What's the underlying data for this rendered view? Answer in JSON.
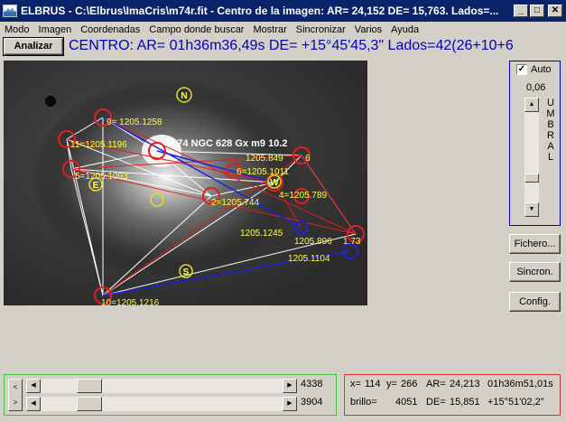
{
  "window": {
    "app_name": "ELBRUS",
    "title": "ELBRUS - C:\\Elbrus\\ImaCris\\m74r.fit - Centro de la imagen: AR= 24,152 DE= 15,763. Lados=..."
  },
  "controls": {
    "minimize": "_",
    "maximize": "□",
    "close": "✕"
  },
  "menu": [
    "Modo",
    "Imagen",
    "Coordenadas",
    "Campo donde buscar",
    "Mostrar",
    "Sincronizar",
    "Varios",
    "Ayuda"
  ],
  "toolbar": {
    "analizar_label": "Analizar",
    "centro_text": "CENTRO: AR= 01h36m36,49s   DE= +15°45'45,3\"  Lados=42(26+10+6"
  },
  "image_labels": {
    "object": "M 74 NGC 628 Gx m9 10.2",
    "stars": [
      "9= 1205.1258",
      "11=1205.1196",
      "5=1205.1093",
      "6=1205.1011",
      "1205.849",
      "6",
      "4=1205.789",
      "2=1205.744",
      "1205.1245",
      "1205.896",
      "1.73",
      "1205.1104",
      "10=1205.1216"
    ],
    "compass": {
      "n": "N",
      "e": "E",
      "w": "W",
      "s": "S"
    }
  },
  "umbral": {
    "auto_label": "Auto",
    "auto_checked": true,
    "value": "0,06",
    "letters": [
      "U",
      "M",
      "B",
      "R",
      "A",
      "L"
    ],
    "slider_level": 0.62
  },
  "side_buttons": {
    "fichero": "Fichero...",
    "sincron": "Sincron.",
    "config": "Config."
  },
  "scrollbars": {
    "horizontal_value": "4338",
    "vertical_value": "3904",
    "h_position": 0.15,
    "v_position": 0.15
  },
  "status": {
    "x_label": "x=",
    "x": "114",
    "y_label": "y=",
    "y": "266",
    "ar_label": "AR=",
    "ar_dec": "24,213",
    "ar_hms": "01h36m51,01s",
    "brillo_label": "brillo=",
    "brillo": "4051",
    "de_label": "DE=",
    "de_dec": "15,851",
    "de_dms": "+15°51'02,2\""
  },
  "colors": {
    "titlebar": "#0a246a",
    "window_bg": "#d4d0c8",
    "centro_text": "#0000c0",
    "star_circle": "#e02020",
    "ref_circle": "#2020e0",
    "marker": "#e0e020",
    "label": "#ffff40",
    "lines_white": "#ffffff",
    "lines_red": "#e02020",
    "lines_blue": "#2020e0"
  }
}
